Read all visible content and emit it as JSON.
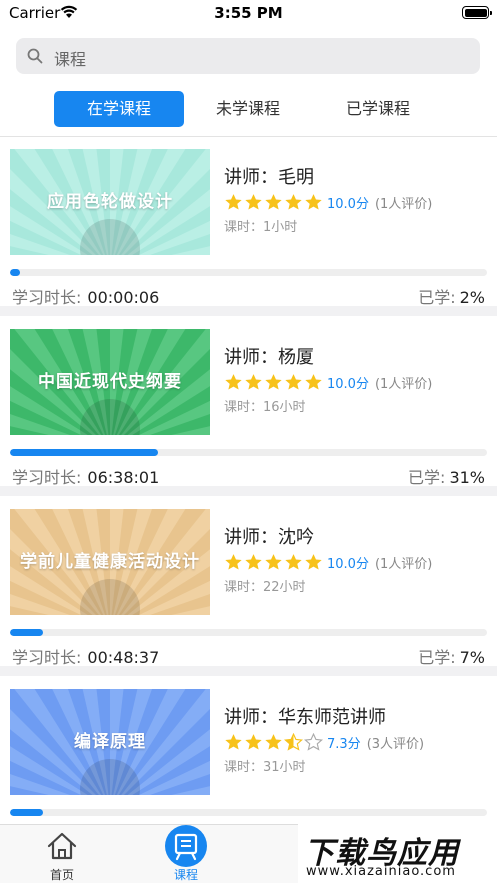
{
  "status_bar": {
    "carrier": "Carrier",
    "time": "3:55 PM"
  },
  "search": {
    "placeholder": "课程"
  },
  "tabs": [
    {
      "label": "在学课程",
      "active": true
    },
    {
      "label": "未学课程",
      "active": false
    },
    {
      "label": "已学课程",
      "active": false
    }
  ],
  "courses": [
    {
      "title": "应用色轮做设计",
      "teacher": "讲师：毛明",
      "stars": 5,
      "score": "10.0分",
      "reviews": "(1人评价)",
      "hours": "课时：1小时",
      "study_label": "学习时长:",
      "study_time": "00:00:06",
      "learned_label": "已学:",
      "learned_pct": "2%",
      "progress": 0.02,
      "bg": "#a8e8dc",
      "ray": "#c8f4ec"
    },
    {
      "title": "中国近现代史纲要",
      "teacher": "讲师：杨厦",
      "stars": 5,
      "score": "10.0分",
      "reviews": "(1人评价)",
      "hours": "课时：16小时",
      "study_label": "学习时长:",
      "study_time": "06:38:01",
      "learned_label": "已学:",
      "learned_pct": "31%",
      "progress": 0.31,
      "bg": "#3db86a",
      "ray": "#6fd494"
    },
    {
      "title": "学前儿童健康活动设计",
      "teacher": "讲师：沈吟",
      "stars": 5,
      "score": "10.0分",
      "reviews": "(1人评价)",
      "hours": "课时：22小时",
      "study_label": "学习时长:",
      "study_time": "00:48:37",
      "learned_label": "已学:",
      "learned_pct": "7%",
      "progress": 0.07,
      "bg": "#e8c48e",
      "ray": "#f6dcb2"
    },
    {
      "title": "编译原理",
      "teacher": "讲师：华东师范讲师",
      "stars": 3.5,
      "score": "7.3分",
      "reviews": "(3人评价)",
      "hours": "课时：31小时",
      "progress": 0.07,
      "bg": "#6e9cf2",
      "ray": "#98bcfa"
    }
  ],
  "tabbar": [
    {
      "label": "首页",
      "icon": "home-icon",
      "active": false
    },
    {
      "label": "课程",
      "icon": "course-icon",
      "active": true
    }
  ],
  "watermark": {
    "main": "下载鸟应用",
    "sub": "www.xiazainiao.com"
  },
  "colors": {
    "accent": "#1786f0",
    "star": "#f7c21a"
  }
}
